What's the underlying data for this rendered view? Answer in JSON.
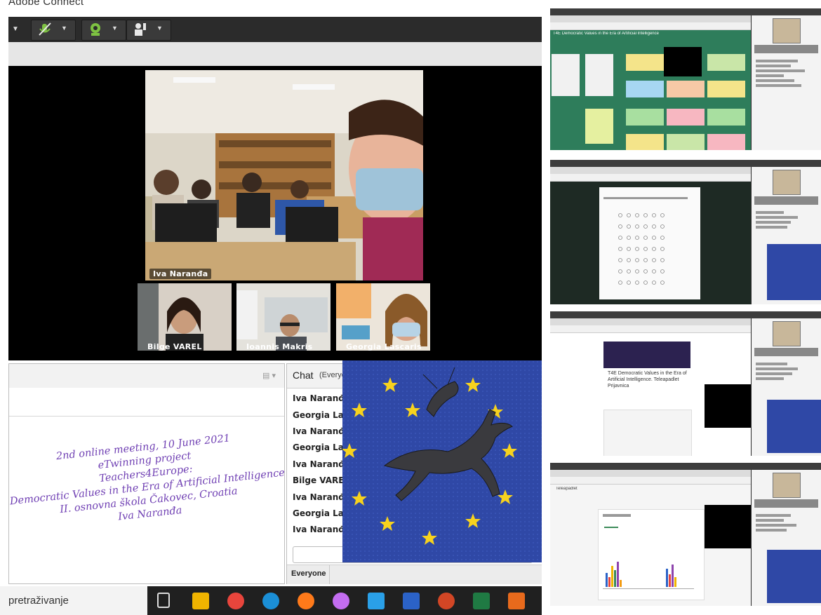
{
  "app": {
    "title": "Adobe Connect"
  },
  "main_video": {
    "presenter": "Iva Naranđa"
  },
  "thumbnails": [
    {
      "name": "Bilge  VAREL"
    },
    {
      "name": "Ioannis Makris"
    },
    {
      "name": "Georgia Lascaris"
    }
  ],
  "share_pod": {
    "lines": [
      "2nd online meeting, 10 June 2021",
      "eTwinning project",
      "Teachers4Europe:",
      "Democratic Values in the Era of Artificial Intelligence",
      "II. osnovna škola Čakovec, Croatia",
      "Iva Naranđa"
    ]
  },
  "chat": {
    "title": "Chat",
    "scope": "(Everyo",
    "messages": [
      {
        "sender": "Iva Naranđa:"
      },
      {
        "sender": "Georgia Lasca"
      },
      {
        "sender": "Iva Naranđa:"
      },
      {
        "sender": "Georgia Lasca"
      },
      {
        "sender": "Iva Naranđa:"
      },
      {
        "sender": "Bilge  VAREL:"
      },
      {
        "sender": "Iva Naranđa:"
      },
      {
        "sender": "Georgia Lasca"
      },
      {
        "sender": "Iva Naranđa:"
      }
    ],
    "footer_tab": "Everyone"
  },
  "taskbar": {
    "search_text": "pretraživanje"
  },
  "right_shots": [
    {
      "title": "T4E Democratic Values in the Era of Artificial Intelligence"
    },
    {
      "title": ""
    },
    {
      "title": "T4E Democratic Values in the Era of Artificial Intelligence. Teleapadlet Prijavnica"
    },
    {
      "title": "Teleapadlet"
    }
  ]
}
